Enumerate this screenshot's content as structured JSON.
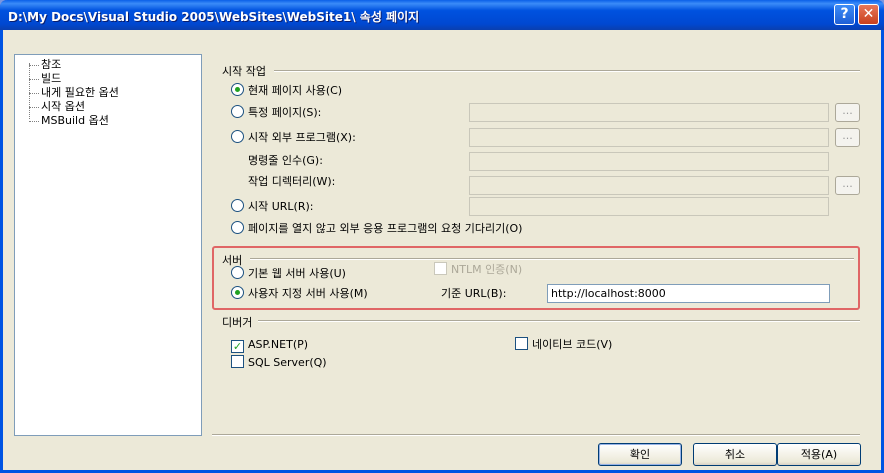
{
  "window": {
    "title": "D:\\My Docs\\Visual Studio 2005\\WebSites\\WebSite1\\ 속성 페이지",
    "help_label": "?",
    "close_label": "✕"
  },
  "tree": {
    "items": [
      {
        "label": "참조"
      },
      {
        "label": "빌드"
      },
      {
        "label": "내게 필요한 옵션"
      },
      {
        "label": "시작 옵션"
      },
      {
        "label": "MSBuild 옵션"
      }
    ]
  },
  "start_action": {
    "group_label": "시작 작업",
    "current_page": "현재 페이지 사용(C)",
    "specific_page": "특정 페이지(S):",
    "external_program": "시작 외부 프로그램(X):",
    "command_args": "명령줄 인수(G):",
    "working_dir": "작업 디렉터리(W):",
    "start_url": "시작 URL(R):",
    "wait_request": "페이지를 열지 않고 외부 응용 프로그램의 요청 기다리기(O)",
    "browse": "..."
  },
  "server": {
    "group_label": "서버",
    "builtin": "기본 웹 서버 사용(U)",
    "ntlm": "NTLM 인증(N)",
    "custom": "사용자 지정 서버 사용(M)",
    "base_url_label": "기준 URL(B):",
    "base_url_value": "http://localhost:8000"
  },
  "debuggers": {
    "group_label": "디버거",
    "aspnet": "ASP.NET(P)",
    "sql": "SQL Server(Q)",
    "native": "네이티브 코드(V)"
  },
  "buttons": {
    "ok": "확인",
    "cancel": "취소",
    "apply": "적용(A)"
  }
}
